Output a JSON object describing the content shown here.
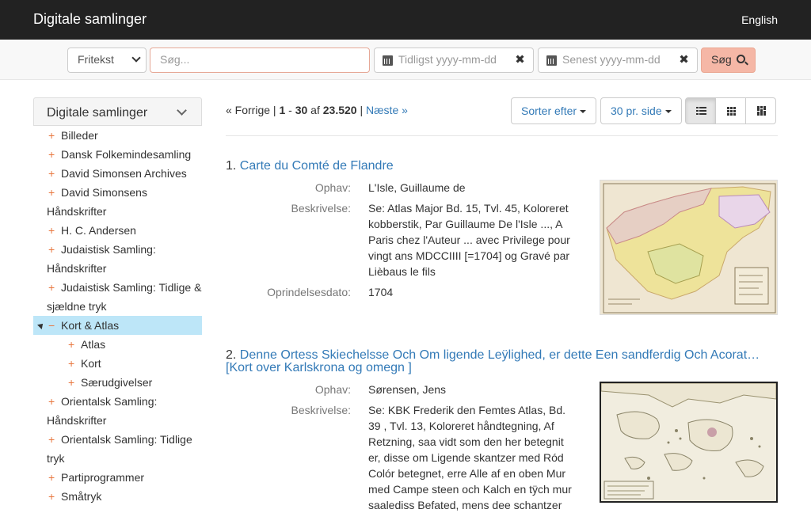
{
  "header": {
    "brand": "Digitale samlinger",
    "language": "English"
  },
  "search": {
    "field_select": "Fritekst",
    "query_placeholder": "Søg...",
    "from_placeholder": "Tidligst yyyy-mm-dd",
    "to_placeholder": "Senest yyyy-mm-dd",
    "clear_symbol": "✖",
    "submit_label": "Søg"
  },
  "sidebar": {
    "title": "Digitale samlinger",
    "items": [
      {
        "label": "Billeder"
      },
      {
        "label": "Dansk Folkemindesamling"
      },
      {
        "label": "David Simonsen Archives"
      },
      {
        "label": "David Simonsens Håndskrifter"
      },
      {
        "label": "H. C. Andersen"
      },
      {
        "label": "Judaistisk Samling: Håndskrifter"
      },
      {
        "label": "Judaistisk Samling: Tidlige & sjældne tryk"
      },
      {
        "label": "Kort & Atlas"
      },
      {
        "label": "Atlas"
      },
      {
        "label": "Kort"
      },
      {
        "label": "Særudgivelser"
      },
      {
        "label": "Orientalsk Samling: Håndskrifter"
      },
      {
        "label": "Orientalsk Samling: Tidlige tryk"
      },
      {
        "label": "Partiprogrammer"
      },
      {
        "label": "Småtryk"
      }
    ]
  },
  "results": {
    "prev": "« Forrige",
    "sep": "|",
    "start": "1",
    "dash": "-",
    "end": "30",
    "of": "af",
    "total": "23.520",
    "next": "Næste »",
    "sort_label": "Sorter efter",
    "per_page_label": "30 pr. side",
    "docs": [
      {
        "number": "1.",
        "title": "Carte du Comté de Flandre",
        "fields": [
          {
            "label": "Ophav:",
            "value": "L'Isle, Guillaume de"
          },
          {
            "label": "Beskrivelse:",
            "value": "Se: Atlas Major Bd. 15, Tvl. 45, Koloreret kobberstik, Par Guillaume De l'Isle ..., A Paris chez l'Auteur ... avec Privilege pour vingt ans MDCCIIII [=1704] og Gravé par Lièbaus le fils"
          },
          {
            "label": "Oprindelsesdato:",
            "value": "1704"
          }
        ]
      },
      {
        "number": "2.",
        "title": "Denne Ortess Skiechelsse Och Om ligende Leÿlighed, er dette Een sandferdig Och Acorat… [Kort over Karlskrona og omegn ]",
        "fields": [
          {
            "label": "Ophav:",
            "value": "Sørensen, Jens"
          },
          {
            "label": "Beskrivelse:",
            "value": "Se: KBK Frederik den Femtes Atlas, Bd. 39 , Tvl. 13, Koloreret håndtegning, Af Retzning, saa vidt som den her betegnit er, disse om Ligende skantzer med Ród Colór betegnet, erre Alle af en oben Mur med Campe steen och Kalch en tÿch mur saalediss Befated, mens dee schantzer"
          }
        ]
      }
    ]
  },
  "colors": {
    "topbar": "#222222",
    "link": "#337ab7",
    "accent": "#f5b7a6",
    "active_tree": "#bde6f8",
    "plus": "#e8763e"
  }
}
